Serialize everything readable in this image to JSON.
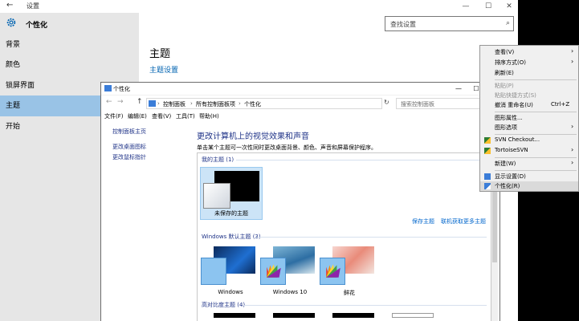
{
  "settings": {
    "back_glyph": "←",
    "window_title": "设置",
    "heading": "个性化",
    "caption": {
      "min": "—",
      "max": "☐",
      "close": "✕"
    },
    "search_placeholder": "查找设置",
    "search_glyph": "⌕",
    "sidebar_items": [
      "背景",
      "颜色",
      "锁屏界面",
      "主题",
      "开始"
    ],
    "active_item": "主题",
    "main_title": "主题",
    "theme_settings_link": "主题设置"
  },
  "personalization": {
    "window_title": "个性化",
    "caption": {
      "min": "—",
      "max": "☐",
      "close": "✕"
    },
    "nav_buttons": [
      "←",
      "→",
      "↑"
    ],
    "breadcrumbs": [
      "控制面板",
      "所有控制面板项",
      "个性化"
    ],
    "breadcrumb_sep": "›",
    "refresh_glyph": "↻",
    "search_placeholder": "搜索控制面板",
    "search_glyph": "⌕",
    "menu": [
      "文件(F)",
      "编辑(E)",
      "查看(V)",
      "工具(T)",
      "帮助(H)"
    ],
    "nav_links": [
      "控制面板主页",
      "更改桌面图标",
      "更改鼠标指针"
    ],
    "heading": "更改计算机上的视觉效果和声音",
    "subheading": "单击某个主题可一次性同时更改桌面背景、颜色、声音和屏幕保护程序。",
    "sections": {
      "my_themes": "我的主题 (1)",
      "windows_defaults": "Windows 默认主题 (3)",
      "high_contrast": "高对比度主题 (4)"
    },
    "unsaved_label": "未保存的主题",
    "save_link": "保存主题",
    "online_link": "联机获取更多主题",
    "default_themes": [
      "Windows",
      "Windows 10",
      "鲜花"
    ]
  },
  "context_menu": {
    "items": [
      {
        "label": "查看(V)",
        "submenu": true,
        "disabled": false
      },
      {
        "label": "排序方式(O)",
        "submenu": true,
        "disabled": false
      },
      {
        "label": "刷新(E)",
        "submenu": false,
        "disabled": false
      },
      {
        "label": "粘贴(P)",
        "submenu": false,
        "disabled": true
      },
      {
        "label": "粘贴快捷方式(S)",
        "submenu": false,
        "disabled": true
      },
      {
        "label": "撤消 重命名(U)",
        "shortcut": "Ctrl+Z",
        "submenu": false,
        "disabled": false
      },
      {
        "label": "图形属性...",
        "submenu": false,
        "disabled": false
      },
      {
        "label": "图形选项",
        "submenu": true,
        "disabled": false
      },
      {
        "label": "SVN Checkout...",
        "submenu": false,
        "disabled": false,
        "icon": "svn-icon"
      },
      {
        "label": "TortoiseSVN",
        "submenu": true,
        "disabled": false,
        "icon": "tortoise-icon"
      },
      {
        "label": "新建(W)",
        "submenu": true,
        "disabled": false
      },
      {
        "label": "显示设置(D)",
        "submenu": false,
        "disabled": false,
        "icon": "display-icon"
      },
      {
        "label": "个性化(R)",
        "submenu": false,
        "disabled": false,
        "icon": "personalize-icon",
        "highlighted": true
      }
    ],
    "arrow_glyph": "›"
  },
  "colors": {
    "accent": "#0063b1",
    "sidebar_active": "#99c3e6",
    "link": "#1e3287"
  }
}
